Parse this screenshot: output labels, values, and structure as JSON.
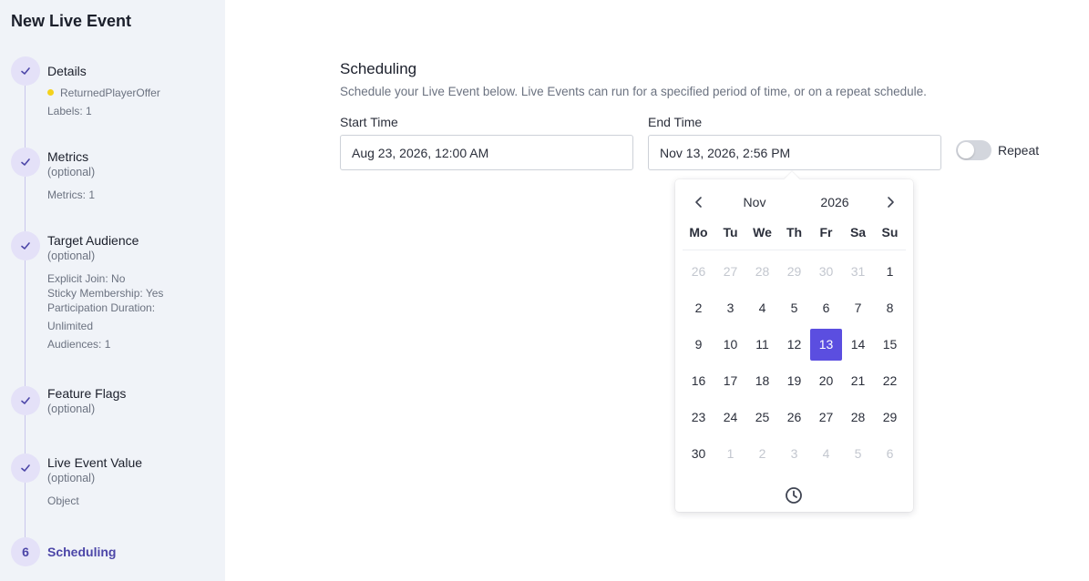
{
  "app_title": "New Live Event",
  "steps": [
    {
      "title": "Details",
      "tag": "ReturnedPlayerOffer",
      "details": [
        "Labels: 1"
      ]
    },
    {
      "title": "Metrics",
      "sub": "(optional)",
      "details": [
        "Metrics: 1"
      ]
    },
    {
      "title": "Target Audience",
      "sub": "(optional)",
      "details": [
        "Explicit Join: No",
        "Sticky Membership: Yes",
        "Participation Duration:",
        "Unlimited",
        "Audiences: 1"
      ]
    },
    {
      "title": "Feature Flags",
      "sub": "(optional)"
    },
    {
      "title": "Live Event Value",
      "sub": "(optional)",
      "details": [
        "Object"
      ]
    },
    {
      "number": "6",
      "title": "Scheduling"
    }
  ],
  "main": {
    "title": "Scheduling",
    "description": "Schedule your Live Event below. Live Events can run for a specified period of time, or on a repeat schedule.",
    "start_label": "Start Time",
    "start_value": "Aug 23, 2026, 12:00 AM",
    "end_label": "End Time",
    "end_value": "Nov 13, 2026, 2:56 PM",
    "repeat_label": "Repeat",
    "repeat_on": false
  },
  "calendar": {
    "month": "Nov",
    "year": "2026",
    "weekdays": [
      "Mo",
      "Tu",
      "We",
      "Th",
      "Fr",
      "Sa",
      "Su"
    ],
    "days": [
      {
        "d": "26",
        "m": true
      },
      {
        "d": "27",
        "m": true
      },
      {
        "d": "28",
        "m": true
      },
      {
        "d": "29",
        "m": true
      },
      {
        "d": "30",
        "m": true
      },
      {
        "d": "31",
        "m": true
      },
      {
        "d": "1"
      },
      {
        "d": "2"
      },
      {
        "d": "3"
      },
      {
        "d": "4"
      },
      {
        "d": "5"
      },
      {
        "d": "6"
      },
      {
        "d": "7"
      },
      {
        "d": "8"
      },
      {
        "d": "9"
      },
      {
        "d": "10"
      },
      {
        "d": "11"
      },
      {
        "d": "12"
      },
      {
        "d": "13",
        "s": true
      },
      {
        "d": "14"
      },
      {
        "d": "15"
      },
      {
        "d": "16"
      },
      {
        "d": "17"
      },
      {
        "d": "18"
      },
      {
        "d": "19"
      },
      {
        "d": "20"
      },
      {
        "d": "21"
      },
      {
        "d": "22"
      },
      {
        "d": "23"
      },
      {
        "d": "24"
      },
      {
        "d": "25"
      },
      {
        "d": "26"
      },
      {
        "d": "27"
      },
      {
        "d": "28"
      },
      {
        "d": "29"
      },
      {
        "d": "30"
      },
      {
        "d": "1",
        "m": true
      },
      {
        "d": "2",
        "m": true
      },
      {
        "d": "3",
        "m": true
      },
      {
        "d": "4",
        "m": true
      },
      {
        "d": "5",
        "m": true
      },
      {
        "d": "6",
        "m": true
      }
    ],
    "icons": [
      "chevron-left-icon",
      "chevron-right-icon",
      "clock-icon"
    ]
  },
  "colors": {
    "accent": "#5b4ee0",
    "sidebar_bg": "#f0f3f8",
    "step_circle": "#e4e1f8",
    "tag_dot": "#f4d21c"
  }
}
